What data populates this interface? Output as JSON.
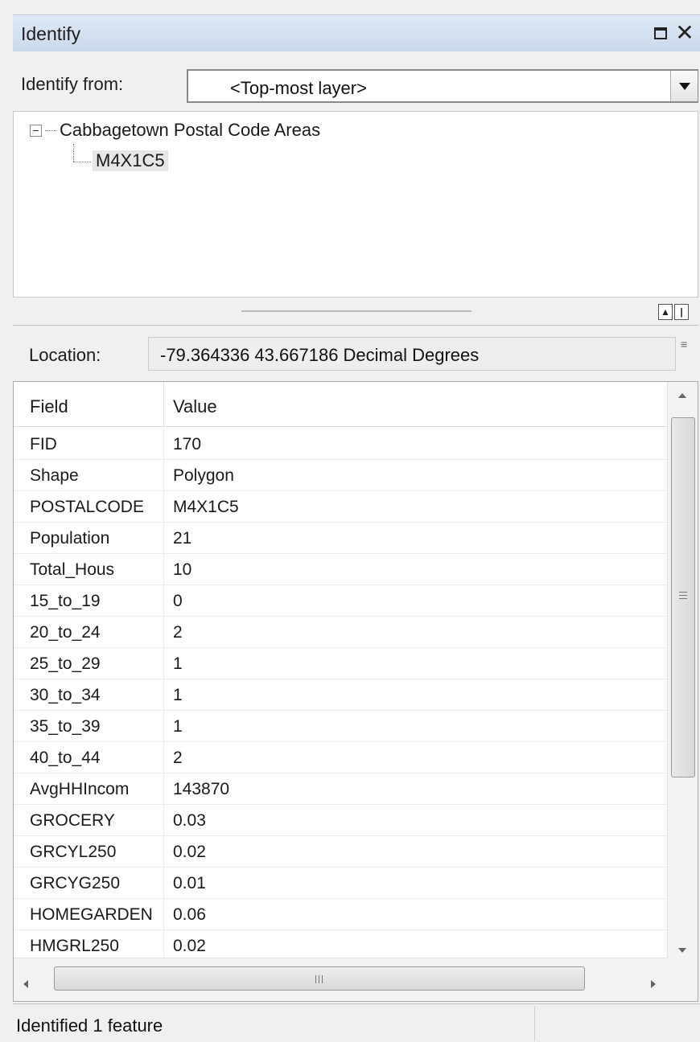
{
  "window": {
    "title": "Identify"
  },
  "identify_from": {
    "label": "Identify from:",
    "selected": "<Top-most layer>"
  },
  "tree": {
    "layer": "Cabbagetown Postal Code Areas",
    "feature": "M4X1C5"
  },
  "location": {
    "label": "Location:",
    "value": "-79.364336  43.667186 Decimal Degrees"
  },
  "grid": {
    "columns": [
      "Field",
      "Value"
    ],
    "rows": [
      [
        "FID",
        "170"
      ],
      [
        "Shape",
        "Polygon"
      ],
      [
        "POSTALCODE",
        "M4X1C5"
      ],
      [
        "Population",
        "21"
      ],
      [
        "Total_Hous",
        "10"
      ],
      [
        "15_to_19",
        "0"
      ],
      [
        "20_to_24",
        "2"
      ],
      [
        "25_to_29",
        "1"
      ],
      [
        "30_to_34",
        "1"
      ],
      [
        "35_to_39",
        "1"
      ],
      [
        "40_to_44",
        "2"
      ],
      [
        "AvgHHIncom",
        "143870"
      ],
      [
        "GROCERY",
        "0.03"
      ],
      [
        "GRCYL250",
        "0.02"
      ],
      [
        "GRCYG250",
        "0.01"
      ],
      [
        "HOMEGARDEN",
        "0.06"
      ],
      [
        "HMGRL250",
        "0.02"
      ]
    ]
  },
  "status": {
    "text": "Identified 1 feature"
  },
  "icons": {
    "restore": "restore-window-icon",
    "close": "close-icon",
    "dropdown": "chevron-down-icon",
    "collapse": "tree-collapse-icon"
  }
}
